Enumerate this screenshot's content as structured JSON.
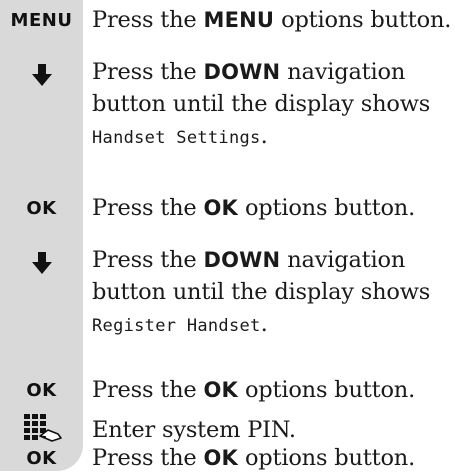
{
  "steps": [
    {
      "key": "MENU",
      "pre": "Press the ",
      "button": "MENU",
      "post": " options button."
    },
    {
      "icon": "down-arrow-icon",
      "pre": "Press the ",
      "button": "DOWN",
      "post": " navigation button until the display shows ",
      "display": "Handset Settings",
      "end": "."
    },
    {
      "key": "OK",
      "pre": "Press the ",
      "button": "OK",
      "post": " options button."
    },
    {
      "icon": "down-arrow-icon",
      "pre": "Press the ",
      "button": "DOWN",
      "post": " navigation button until the display shows ",
      "display": "Register Handset",
      "end": "."
    },
    {
      "key": "OK",
      "pre": "Press the ",
      "button": "OK",
      "post": " options button."
    },
    {
      "icon": "keypad-hand-icon",
      "text": "Enter system PIN."
    },
    {
      "key": "OK",
      "pre": "Press the ",
      "button": "OK",
      "post": " options button."
    }
  ]
}
